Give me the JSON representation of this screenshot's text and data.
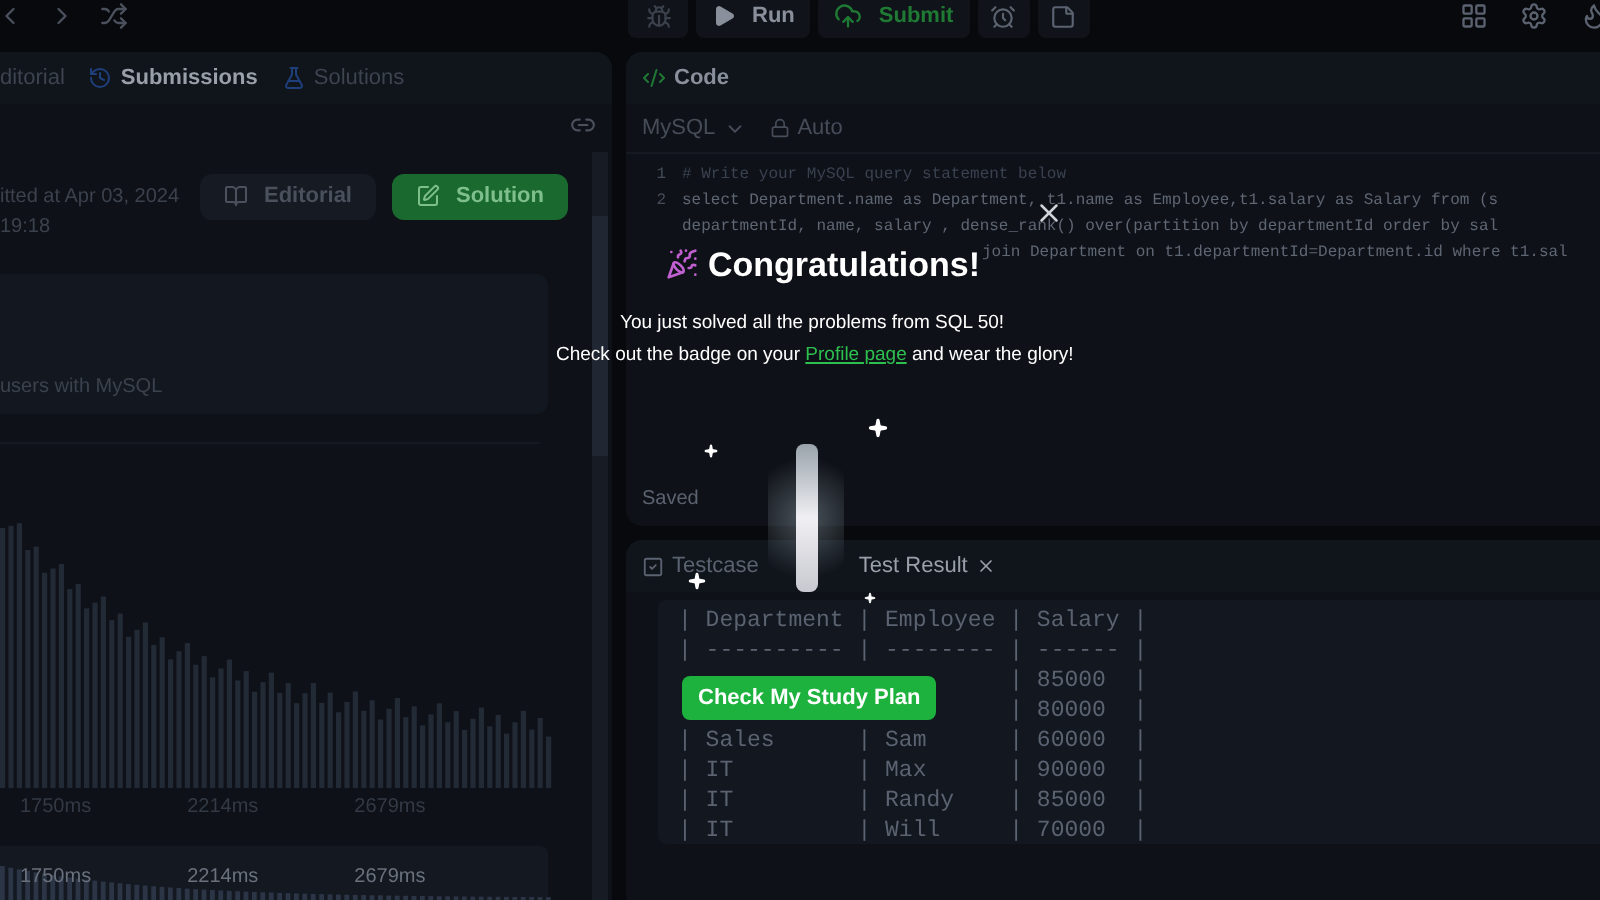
{
  "toolbar": {
    "run": "Run",
    "submit": "Submit"
  },
  "left_panel": {
    "tabs": [
      {
        "label": "ditorial",
        "selected": false
      },
      {
        "label": "Submissions",
        "selected": true
      },
      {
        "label": "Solutions",
        "selected": false
      }
    ],
    "buttons": [
      {
        "label": "Editorial",
        "kind": "plain"
      },
      {
        "label": "Solution",
        "kind": "primary"
      }
    ],
    "submitted": "itted at Apr 03, 2024 19:18",
    "card_text": "users with MySQL",
    "histogram_ticks": [
      "1750ms",
      "2214ms",
      "2679ms"
    ],
    "overview_ticks": [
      "1750ms",
      "2214ms",
      "2679ms"
    ]
  },
  "code_panel": {
    "title": "Code",
    "language": "MySQL",
    "mode": "Auto",
    "lines": [
      {
        "number": "1",
        "text": "# Write your MySQL query statement below",
        "kind": "comment"
      },
      {
        "number": "2",
        "text": "select Department.name as Department, t1.name as Employee,t1.salary as Salary from (s",
        "kind": "code"
      },
      {
        "text": "departmentId, name, salary , dense_rank() over(partition by departmentId order by sal",
        "kind": "wrap"
      },
      {
        "text": "join Department on t1.departmentId=Department.id where t1.sal",
        "kind": "tail"
      }
    ],
    "status": "Saved"
  },
  "result_panel": {
    "tabs": [
      {
        "label": "Testcase",
        "selected": false
      },
      {
        "label": "Test Result",
        "selected": true
      }
    ],
    "lines": [
      {
        "text": "| Department | Employee | Salary |",
        "kind": "full"
      },
      {
        "text": "| ---------- | -------- | ------ |",
        "kind": "full"
      },
      {
        "text": "| 85000  |",
        "kind": "partial"
      },
      {
        "text": "| 80000  |",
        "kind": "partial"
      },
      {
        "text": "| Sales      | Sam      | 60000  |",
        "kind": "full"
      },
      {
        "text": "| IT         | Max      | 90000  |",
        "kind": "full"
      },
      {
        "text": "| IT         | Randy    | 85000  |",
        "kind": "full"
      },
      {
        "text": "| IT         | Will     | 70000  |",
        "kind": "full"
      }
    ]
  },
  "modal": {
    "title": "Congratulations!",
    "message": "You just solved all the problems from SQL 50!",
    "line2_before": "Check out the badge on your",
    "link": "Profile page",
    "line2_after": "and wear the glory!",
    "button": "Check My Study Plan"
  }
}
